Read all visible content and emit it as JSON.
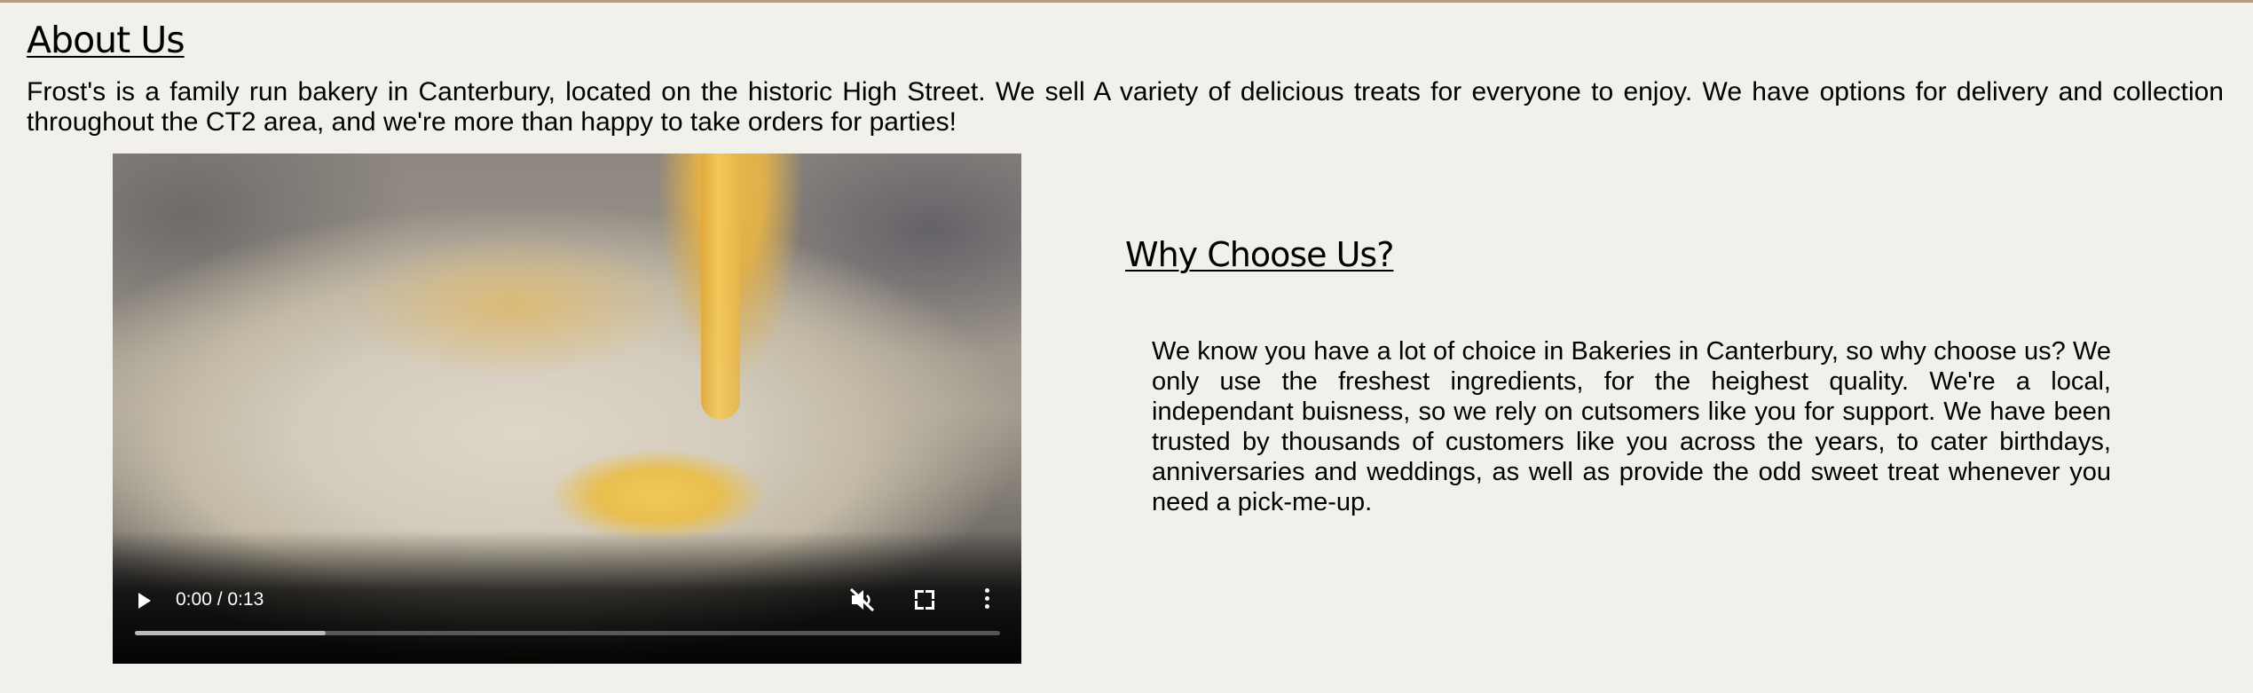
{
  "about": {
    "heading": "About Us",
    "text": "Frost's is a family run bakery in Canterbury, located on the historic High Street. We sell A variety of delicious treats for everyone to enjoy. We have options for delivery and collection throughout the CT2 area, and we're more than happy to take orders for parties!"
  },
  "video": {
    "time_display": "0:00 / 0:13",
    "buffered_fraction": 0.22,
    "controls": {
      "play_icon": "play-icon",
      "mute_icon": "volume-muted-icon",
      "fullscreen_icon": "fullscreen-icon",
      "more_icon": "more-vertical-icon"
    }
  },
  "why": {
    "heading": "Why Choose Us?",
    "text": "We know you have a lot of choice in Bakeries in Canterbury, so why choose us? We only use the freshest ingredients, for the heighest quality. We're a local, independant buisness, so we rely on cutsomers like you for support. We have been trusted by thousands of customers like you across the years, to cater birthdays, anniversaries and weddings, as well as provide the odd sweet treat whenever you need a pick-me-up."
  },
  "colors": {
    "background": "#f1f0eb",
    "top_border": "#b89a7d"
  }
}
